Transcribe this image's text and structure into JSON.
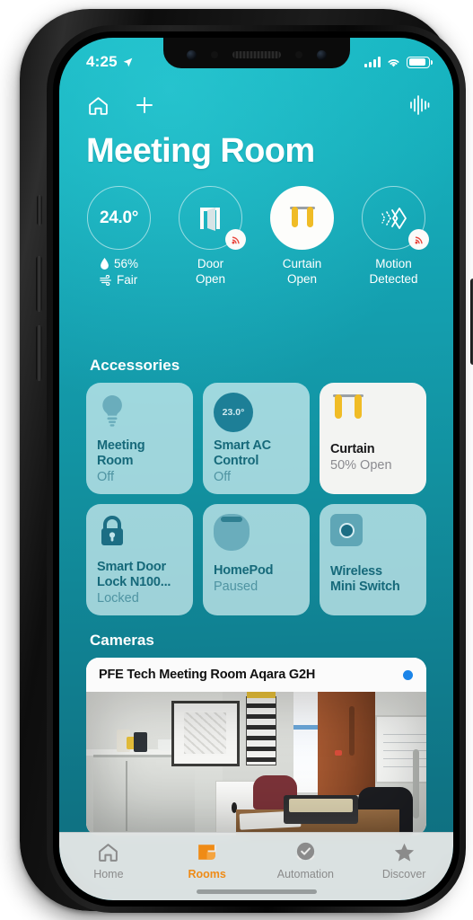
{
  "device": {
    "frame": "iphone-x"
  },
  "status_bar": {
    "time": "4:25",
    "location_icon": "location-arrow-icon",
    "cellular_icon": "cellular-bars-icon",
    "wifi_icon": "wifi-icon",
    "battery_icon": "battery-icon"
  },
  "app_nav": {
    "home_icon": "home-icon",
    "add_icon": "plus-icon",
    "voice_icon": "voice-waveform-icon"
  },
  "header": {
    "title": "Meeting Room"
  },
  "sensors": [
    {
      "id": "climate",
      "value": "24.0°",
      "humidity": "56%",
      "air_quality": "Fair",
      "humidity_icon": "water-drop-icon",
      "air_icon": "air-quality-icon",
      "state": "outline"
    },
    {
      "id": "door",
      "icon": "door-open-icon",
      "label_line1": "Door",
      "label_line2": "Open",
      "badge_icon": "signal-waves-icon",
      "state": "outline"
    },
    {
      "id": "curtain",
      "icon": "curtain-icon",
      "label_line1": "Curtain",
      "label_line2": "Open",
      "state": "filled"
    },
    {
      "id": "motion",
      "icon": "motion-sensor-icon",
      "label_line1": "Motion",
      "label_line2": "Detected",
      "badge_icon": "signal-waves-icon",
      "state": "outline"
    }
  ],
  "accessories": {
    "section_title": "Accessories",
    "items": [
      {
        "name_line1": "Meeting",
        "name_line2": "Room",
        "status": "Off",
        "icon": "lightbulb-icon",
        "on": false
      },
      {
        "name_line1": "Smart AC",
        "name_line2": "Control",
        "status": "Off",
        "icon": "thermostat-icon",
        "badge_value": "23.0°",
        "on": false
      },
      {
        "name_line1": "Curtain",
        "name_line2": "",
        "status": "50% Open",
        "icon": "curtain-icon",
        "on": true
      },
      {
        "name_line1": "Smart Door",
        "name_line2": "Lock N100...",
        "status": "Locked",
        "icon": "lock-icon",
        "on": false
      },
      {
        "name_line1": "HomePod",
        "name_line2": "",
        "status": "Paused",
        "icon": "homepod-icon",
        "on": false
      },
      {
        "name_line1": "Wireless",
        "name_line2": "Mini Switch",
        "status": "",
        "icon": "mini-switch-icon",
        "on": false
      }
    ]
  },
  "cameras": {
    "section_title": "Cameras",
    "items": [
      {
        "title": "PFE Tech Meeting Room Aqara G2H",
        "status_dot": "live-indicator"
      }
    ]
  },
  "tab_bar": {
    "active": "Rooms",
    "accent_color": "#ef8b16",
    "items": [
      {
        "label": "Home",
        "icon": "home-icon"
      },
      {
        "label": "Rooms",
        "icon": "rooms-icon"
      },
      {
        "label": "Automation",
        "icon": "automation-clock-icon"
      },
      {
        "label": "Discover",
        "icon": "star-icon"
      }
    ]
  },
  "colors": {
    "background_top": "#17b6c2",
    "background_bottom": "#0e6d7e",
    "card": "#d6f0f3",
    "card_text": "#16697a",
    "accent_orange": "#ef8b16",
    "curtain_yellow": "#f0bc26",
    "live_blue": "#1b84e8"
  }
}
